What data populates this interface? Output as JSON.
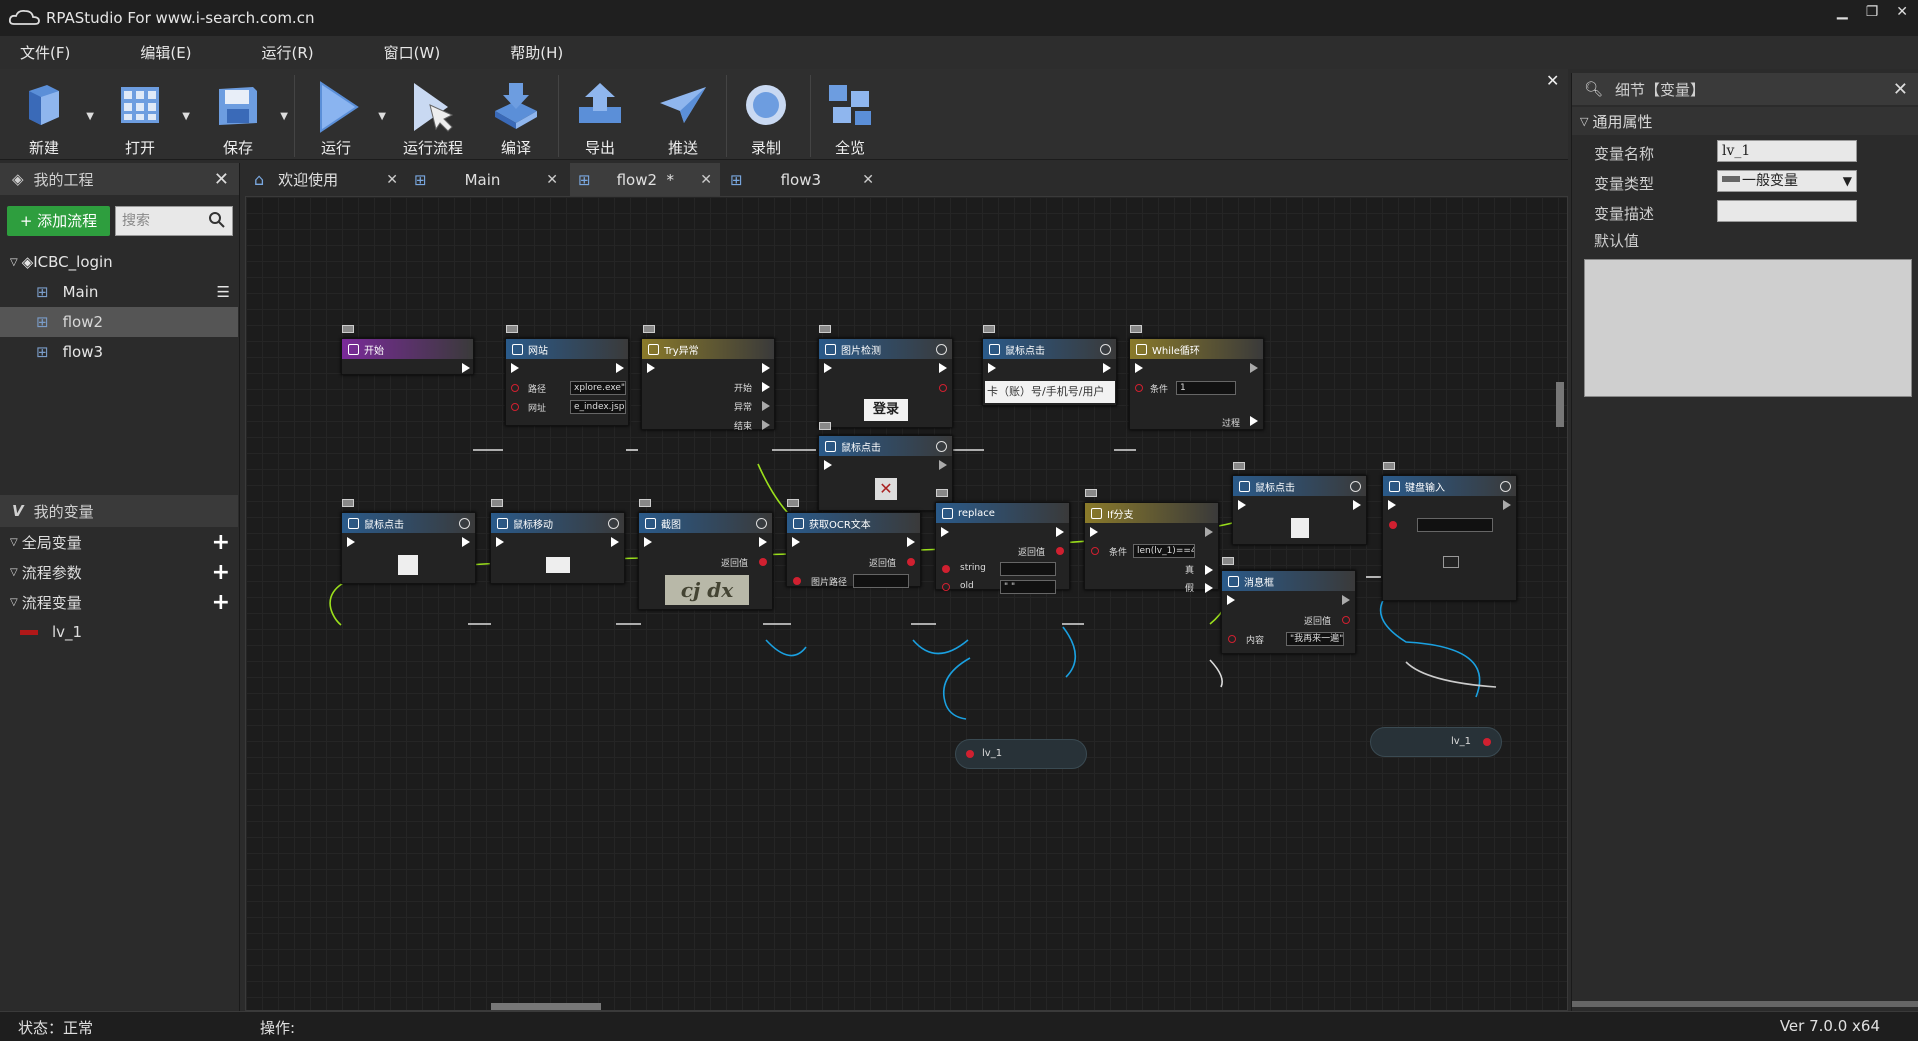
{
  "window": {
    "title": "RPAStudio For www.i-search.com.cn"
  },
  "menu": [
    "文件(F)",
    "编辑(E)",
    "运行(R)",
    "窗口(W)",
    "帮助(H)"
  ],
  "toolbar": {
    "new": "新建",
    "open": "打开",
    "save": "保存",
    "run": "运行",
    "run_flow": "运行流程",
    "compile": "编译",
    "export": "导出",
    "push": "推送",
    "record": "录制",
    "overview": "全览"
  },
  "project_panel": {
    "title": "我的工程",
    "add_flow": "+ 添加流程",
    "search_placeholder": "搜索",
    "project": "ICBC_login",
    "flows": [
      "Main",
      "flow2",
      "flow3"
    ]
  },
  "variables_panel": {
    "title": "我的变量",
    "global": "全局变量",
    "params": "流程参数",
    "flow_vars": "流程变量",
    "var1": "lv_1"
  },
  "tabs": [
    {
      "label": "欢迎使用"
    },
    {
      "label": "Main"
    },
    {
      "label": "flow2  *"
    },
    {
      "label": "flow3"
    }
  ],
  "nodes": {
    "start": "开始",
    "website": "网站",
    "website_path_label": "路径",
    "website_path": "xplore.exe\"",
    "website_url_label": "网址",
    "website_url": "e_index.jsp\"",
    "try": "Try异常",
    "try_start": "开始",
    "try_except": "异常",
    "try_end": "结束",
    "image_detect": "图片检测",
    "image_detect_text": "登录",
    "mouse_click1": "鼠标点击",
    "mouse_click1_text": "卡（账）号/手机号/用户",
    "while": "While循环",
    "while_cond_label": "条件",
    "while_cond": "1",
    "while_body": "过程",
    "mouse_click2": "鼠标点击",
    "mouse_click3": "鼠标点击",
    "mouse_move": "鼠标移动",
    "screenshot": "截图",
    "screenshot_ret": "返回值",
    "captcha_text": "cj dx",
    "ocr": "获取OCR文本",
    "ocr_ret": "返回值",
    "ocr_path": "图片路径",
    "replace": "replace",
    "replace_ret": "返回值",
    "replace_string": "string",
    "replace_old": "old",
    "replace_old_val": "\" \"",
    "if": "If分支",
    "if_cond_label": "条件",
    "if_cond": "len(lv_1)==4",
    "if_true": "真",
    "if_false": "假",
    "mouse_click4": "鼠标点击",
    "keyboard": "键盘输入",
    "msgbox": "消息框",
    "msgbox_ret": "返回值",
    "msgbox_content_label": "内容",
    "msgbox_content": "\"我再来一遍\"",
    "var_pill1": "lv_1",
    "var_pill2": "lv_1"
  },
  "details_panel": {
    "title": "细节【变量】",
    "section": "通用属性",
    "name_label": "变量名称",
    "name_value": "lv_1",
    "type_label": "变量类型",
    "type_value": "一般变量",
    "desc_label": "变量描述",
    "default_label": "默认值"
  },
  "status": {
    "state": "状态：正常",
    "operation": "操作:",
    "version": "Ver 7.0.0 x64"
  },
  "colors": {
    "green_button": "#2e9e3e",
    "wire_green": "#9be01c",
    "wire_blue": "#1aa0e0",
    "pin_red": "#d02030"
  }
}
